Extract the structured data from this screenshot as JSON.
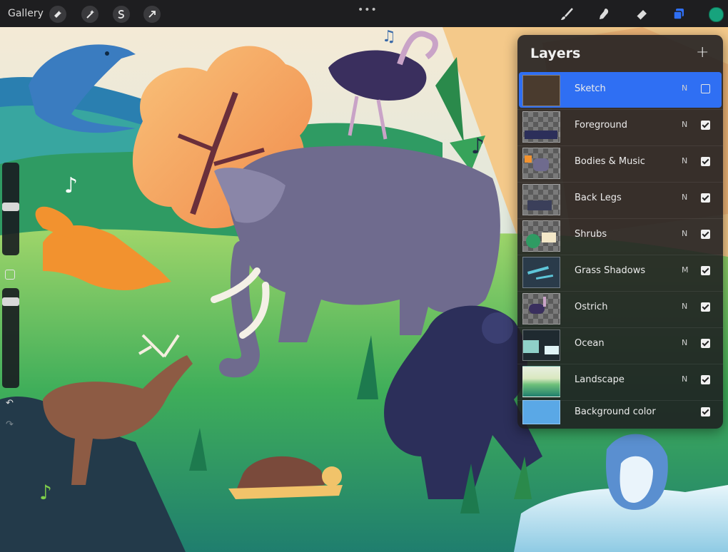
{
  "toolbar": {
    "gallery_label": "Gallery",
    "left_tools": [
      "wrench-icon",
      "magic-wand-icon",
      "selection-s-icon",
      "transform-arrow-icon"
    ],
    "more_label": "•••",
    "right_tools": [
      "brush-icon",
      "smudge-icon",
      "eraser-icon",
      "layers-icon"
    ],
    "current_color": "#17a37d"
  },
  "layers_panel": {
    "title": "Layers",
    "add_label": "+",
    "items": [
      {
        "name": "Sketch",
        "mode": "N",
        "visible": false,
        "selected": true
      },
      {
        "name": "Foreground",
        "mode": "N",
        "visible": true,
        "selected": false
      },
      {
        "name": "Bodies & Music",
        "mode": "N",
        "visible": true,
        "selected": false
      },
      {
        "name": "Back Legs",
        "mode": "N",
        "visible": true,
        "selected": false
      },
      {
        "name": "Shrubs",
        "mode": "N",
        "visible": true,
        "selected": false
      },
      {
        "name": "Grass Shadows",
        "mode": "M",
        "visible": true,
        "selected": false
      },
      {
        "name": "Ostrich",
        "mode": "N",
        "visible": true,
        "selected": false
      },
      {
        "name": "Ocean",
        "mode": "N",
        "visible": true,
        "selected": false
      },
      {
        "name": "Landscape",
        "mode": "N",
        "visible": true,
        "selected": false
      },
      {
        "name": "Background color",
        "mode": "",
        "visible": true,
        "selected": false
      }
    ]
  },
  "sidebar": {
    "undo_label": "↶",
    "redo_label": "↷"
  },
  "colors": {
    "accent_blue": "#2f6ff3",
    "toolbar_bg": "#1e1e20",
    "background_layer": "#5aa8e6"
  }
}
